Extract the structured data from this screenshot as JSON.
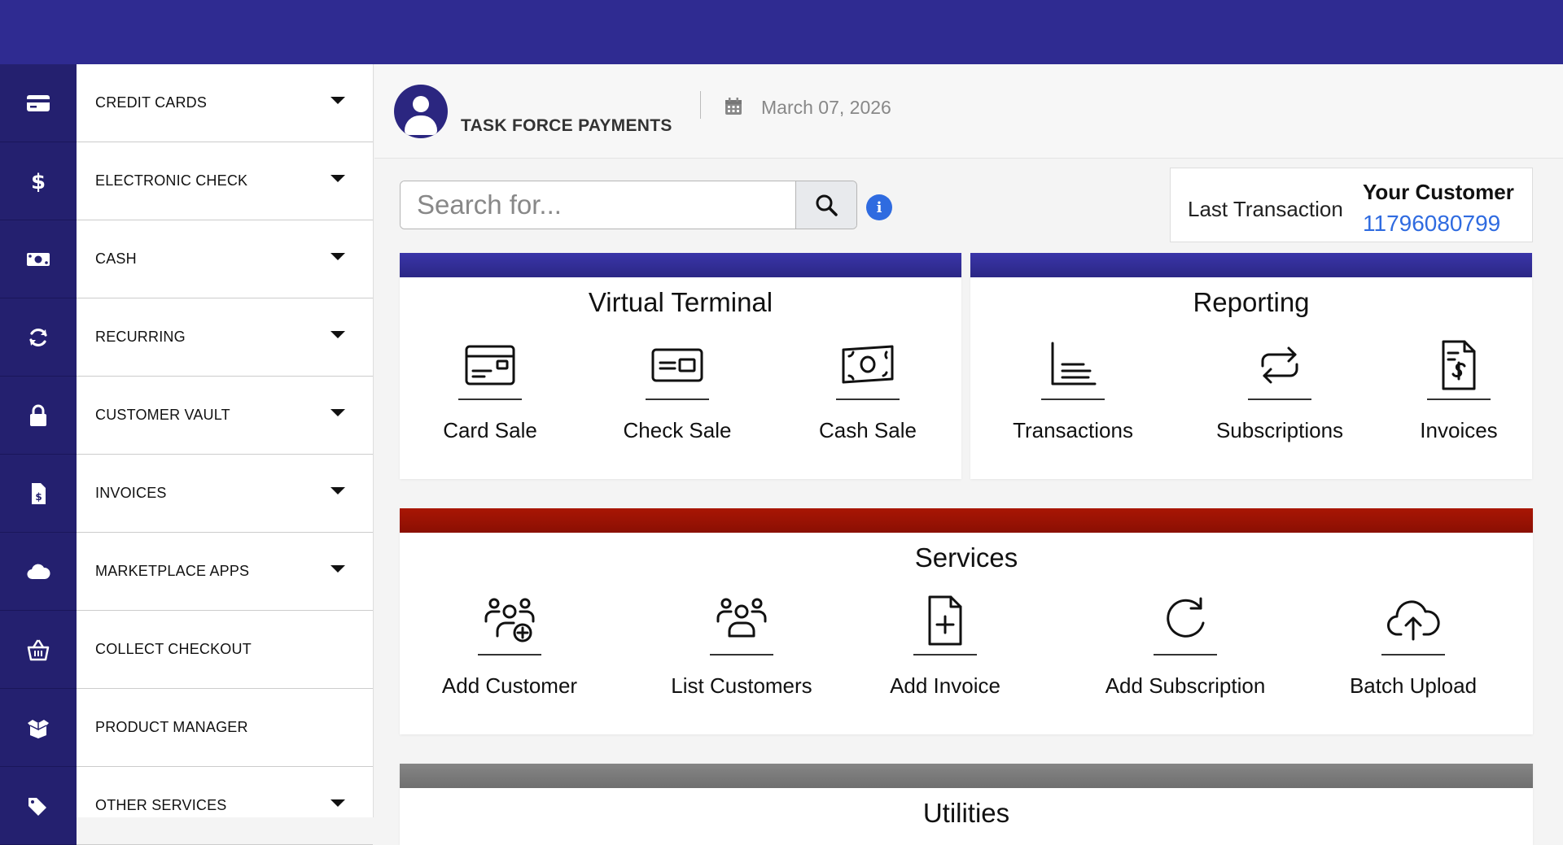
{
  "sidebar": {
    "items": [
      {
        "label": "CREDIT CARDS",
        "icon": "credit-card-icon",
        "has_caret": true
      },
      {
        "label": "ELECTRONIC CHECK",
        "icon": "dollar-icon",
        "has_caret": true
      },
      {
        "label": "CASH",
        "icon": "money-icon",
        "has_caret": true
      },
      {
        "label": "RECURRING",
        "icon": "sync-icon",
        "has_caret": true
      },
      {
        "label": "CUSTOMER VAULT",
        "icon": "lock-icon",
        "has_caret": true
      },
      {
        "label": "INVOICES",
        "icon": "invoice-icon",
        "has_caret": true
      },
      {
        "label": "MARKETPLACE APPS",
        "icon": "cloud-icon",
        "has_caret": true
      },
      {
        "label": "COLLECT CHECKOUT",
        "icon": "basket-icon",
        "has_caret": false
      },
      {
        "label": "PRODUCT MANAGER",
        "icon": "box-icon",
        "has_caret": false
      },
      {
        "label": "OTHER SERVICES",
        "icon": "tags-icon",
        "has_caret": true
      }
    ]
  },
  "header": {
    "company": "TASK FORCE PAYMENTS",
    "date": "March 07, 2026"
  },
  "search": {
    "placeholder": "Search for..."
  },
  "last_transaction": {
    "label": "Last Transaction",
    "customer": "Your Customer",
    "number": "11796080799"
  },
  "virtual_terminal": {
    "title": "Virtual Terminal",
    "band_color": "#2f2b91",
    "tiles": [
      {
        "label": "Card Sale",
        "icon": "card-icon"
      },
      {
        "label": "Check Sale",
        "icon": "check-icon"
      },
      {
        "label": "Cash Sale",
        "icon": "cash-icon"
      }
    ]
  },
  "reporting": {
    "title": "Reporting",
    "band_color": "#2f2b91",
    "tiles": [
      {
        "label": "Transactions",
        "icon": "list-chart-icon"
      },
      {
        "label": "Subscriptions",
        "icon": "repeat-icon"
      },
      {
        "label": "Invoices",
        "icon": "invoice-doc-icon"
      }
    ]
  },
  "services": {
    "title": "Services",
    "band_color": "#9a1204",
    "tiles": [
      {
        "label": "Add Customer",
        "icon": "add-users-icon"
      },
      {
        "label": "List Customers",
        "icon": "users-icon"
      },
      {
        "label": "Add Invoice",
        "icon": "file-plus-icon"
      },
      {
        "label": "Add Subscription",
        "icon": "refresh-icon"
      },
      {
        "label": "Batch Upload",
        "icon": "cloud-upload-icon"
      }
    ]
  },
  "utilities": {
    "title": "Utilities",
    "band_color": "#7a7a7a"
  }
}
